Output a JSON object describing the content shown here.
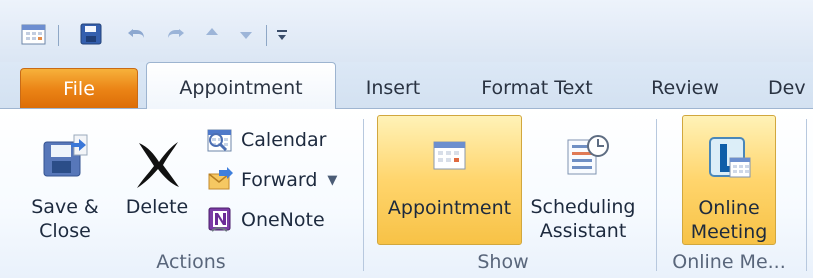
{
  "window": {
    "tabs": {
      "file": "File",
      "appointment": "Appointment",
      "insert": "Insert",
      "format_text": "Format Text",
      "review": "Review",
      "developer_partial": "Dev"
    }
  },
  "ribbon": {
    "groups": {
      "actions": {
        "label": "Actions",
        "buttons": {
          "save_close_line1": "Save &",
          "save_close_line2": "Close",
          "delete": "Delete",
          "calendar": "Calendar",
          "forward": "Forward",
          "onenote": "OneNote"
        }
      },
      "show": {
        "label": "Show",
        "buttons": {
          "appointment": "Appointment",
          "scheduling_line1": "Scheduling",
          "scheduling_line2": "Assistant"
        }
      },
      "online_meeting": {
        "label": "Online Me...",
        "buttons": {
          "online_line1": "Online",
          "online_line2": "Meeting"
        }
      }
    }
  },
  "icons": {
    "qat": [
      "calendar-grid-icon",
      "save-icon",
      "undo-icon",
      "redo-icon",
      "up-arrow-icon",
      "down-arrow-icon",
      "customize-toolbar-icon"
    ],
    "ribbon": [
      "save-close-icon",
      "delete-x-icon",
      "calendar-icon",
      "forward-icon",
      "onenote-icon",
      "appointment-calendar-icon",
      "scheduling-assistant-icon",
      "online-meeting-icon"
    ]
  },
  "colors": {
    "file_tab": "#eb8416",
    "selected_button": "#ffd56d",
    "ribbon_border": "#9fb5d1"
  }
}
